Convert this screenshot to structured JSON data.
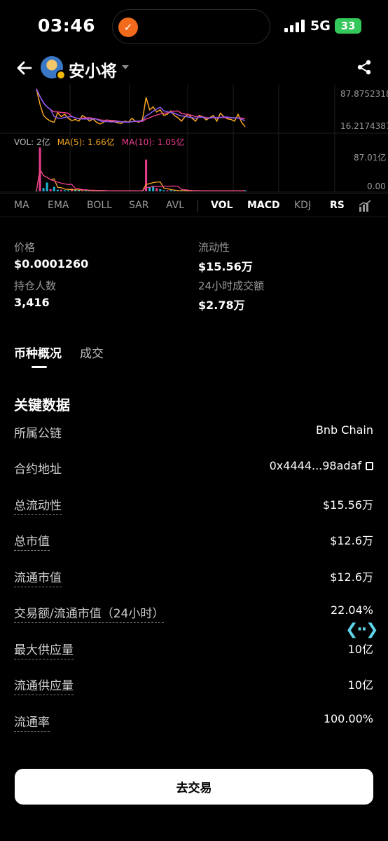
{
  "status_bar": {
    "time": "03:46",
    "network": "5G",
    "battery": "33"
  },
  "header": {
    "title": "安小将"
  },
  "chart": {
    "price_high_label": "87.8752318",
    "price_low_label": "16.2174387",
    "vol_max_label": "87.01亿",
    "vol_min_label": "0.00",
    "vol_legend": "VOL: 2亿",
    "ma5_legend": "MA(5): 1.66亿",
    "ma10_legend": "MA(10): 1.05亿",
    "colors": {
      "price": "#f5a623",
      "ma_purple": "#8a5cf6",
      "ma_pink": "#e83e8c",
      "volume": "#1fb5d4"
    }
  },
  "chart_data": {
    "type": "line",
    "price_axis": [
      16.2174387,
      87.8752318
    ],
    "volume_axis": [
      0,
      87.01
    ],
    "price": [
      87,
      60,
      40,
      34,
      30,
      28,
      45,
      38,
      42,
      35,
      31,
      33,
      30,
      40,
      36,
      30,
      34,
      28,
      25,
      28,
      32,
      30,
      29,
      27,
      26,
      30,
      28,
      35,
      30,
      28,
      33,
      72,
      50,
      55,
      46,
      50,
      40,
      42,
      48,
      40,
      36,
      30,
      38,
      42,
      35,
      30,
      40,
      38,
      32,
      36,
      40,
      30,
      44,
      38,
      34,
      33,
      30,
      42,
      28,
      20
    ],
    "volume": [
      0.2,
      80,
      6,
      16,
      4,
      8,
      3,
      3,
      2,
      2,
      5,
      2,
      2,
      1,
      1,
      1,
      1,
      1,
      1,
      1,
      1,
      1,
      1,
      1,
      1,
      1,
      1,
      1,
      1,
      1,
      2,
      58,
      8,
      10,
      6,
      4,
      2,
      2,
      2,
      1,
      1,
      1,
      1,
      1,
      1,
      1,
      1,
      1,
      1,
      1,
      1,
      1,
      1,
      1,
      1,
      1,
      1,
      1,
      1,
      2
    ]
  },
  "indicators": [
    "MA",
    "EMA",
    "BOLL",
    "SAR",
    "AVL",
    "VOL",
    "MACD",
    "KDJ",
    "RS"
  ],
  "stats": {
    "price_label": "价格",
    "price_value": "$0.0001260",
    "liquidity_label": "流动性",
    "liquidity_value": "$15.56万",
    "holders_label": "持仓人数",
    "holders_value": "3,416",
    "volume24_label": "24小时成交额",
    "volume24_value": "$2.78万"
  },
  "tabs": {
    "overview": "币种概况",
    "trades": "成交"
  },
  "key_data": {
    "title": "关键数据",
    "rows": [
      {
        "label": "所属公链",
        "value": "Bnb Chain"
      },
      {
        "label": "合约地址",
        "value": "0x4444...98adaf"
      },
      {
        "label": "总流动性",
        "value": "$15.56万"
      },
      {
        "label": "总市值",
        "value": "$12.6万"
      },
      {
        "label": "流通市值",
        "value": "$12.6万"
      },
      {
        "label": "交易额/流通市值（24小时）",
        "value": "22.04%"
      },
      {
        "label": "最大供应量",
        "value": "10亿"
      },
      {
        "label": "流通供应量",
        "value": "10亿"
      },
      {
        "label": "流通率",
        "value": "100.00%"
      }
    ]
  },
  "trade_button": "去交易"
}
